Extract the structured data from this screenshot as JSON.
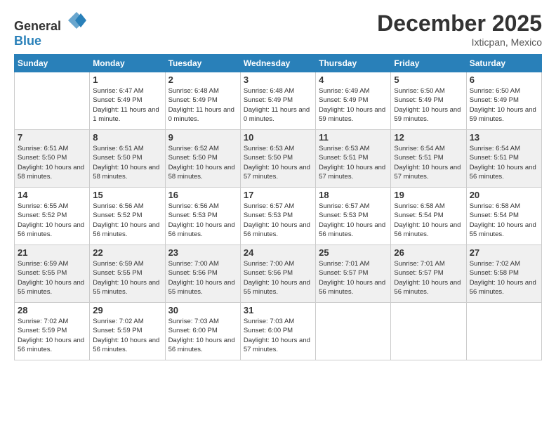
{
  "header": {
    "logo_general": "General",
    "logo_blue": "Blue",
    "month_title": "December 2025",
    "location": "Ixticpan, Mexico"
  },
  "days_of_week": [
    "Sunday",
    "Monday",
    "Tuesday",
    "Wednesday",
    "Thursday",
    "Friday",
    "Saturday"
  ],
  "weeks": [
    [
      {
        "day": "",
        "sunrise": "",
        "sunset": "",
        "daylight": "",
        "empty": true
      },
      {
        "day": "1",
        "sunrise": "Sunrise: 6:47 AM",
        "sunset": "Sunset: 5:49 PM",
        "daylight": "Daylight: 11 hours and 1 minute."
      },
      {
        "day": "2",
        "sunrise": "Sunrise: 6:48 AM",
        "sunset": "Sunset: 5:49 PM",
        "daylight": "Daylight: 11 hours and 0 minutes."
      },
      {
        "day": "3",
        "sunrise": "Sunrise: 6:48 AM",
        "sunset": "Sunset: 5:49 PM",
        "daylight": "Daylight: 11 hours and 0 minutes."
      },
      {
        "day": "4",
        "sunrise": "Sunrise: 6:49 AM",
        "sunset": "Sunset: 5:49 PM",
        "daylight": "Daylight: 10 hours and 59 minutes."
      },
      {
        "day": "5",
        "sunrise": "Sunrise: 6:50 AM",
        "sunset": "Sunset: 5:49 PM",
        "daylight": "Daylight: 10 hours and 59 minutes."
      },
      {
        "day": "6",
        "sunrise": "Sunrise: 6:50 AM",
        "sunset": "Sunset: 5:49 PM",
        "daylight": "Daylight: 10 hours and 59 minutes."
      }
    ],
    [
      {
        "day": "7",
        "sunrise": "Sunrise: 6:51 AM",
        "sunset": "Sunset: 5:50 PM",
        "daylight": "Daylight: 10 hours and 58 minutes."
      },
      {
        "day": "8",
        "sunrise": "Sunrise: 6:51 AM",
        "sunset": "Sunset: 5:50 PM",
        "daylight": "Daylight: 10 hours and 58 minutes."
      },
      {
        "day": "9",
        "sunrise": "Sunrise: 6:52 AM",
        "sunset": "Sunset: 5:50 PM",
        "daylight": "Daylight: 10 hours and 58 minutes."
      },
      {
        "day": "10",
        "sunrise": "Sunrise: 6:53 AM",
        "sunset": "Sunset: 5:50 PM",
        "daylight": "Daylight: 10 hours and 57 minutes."
      },
      {
        "day": "11",
        "sunrise": "Sunrise: 6:53 AM",
        "sunset": "Sunset: 5:51 PM",
        "daylight": "Daylight: 10 hours and 57 minutes."
      },
      {
        "day": "12",
        "sunrise": "Sunrise: 6:54 AM",
        "sunset": "Sunset: 5:51 PM",
        "daylight": "Daylight: 10 hours and 57 minutes."
      },
      {
        "day": "13",
        "sunrise": "Sunrise: 6:54 AM",
        "sunset": "Sunset: 5:51 PM",
        "daylight": "Daylight: 10 hours and 56 minutes."
      }
    ],
    [
      {
        "day": "14",
        "sunrise": "Sunrise: 6:55 AM",
        "sunset": "Sunset: 5:52 PM",
        "daylight": "Daylight: 10 hours and 56 minutes."
      },
      {
        "day": "15",
        "sunrise": "Sunrise: 6:56 AM",
        "sunset": "Sunset: 5:52 PM",
        "daylight": "Daylight: 10 hours and 56 minutes."
      },
      {
        "day": "16",
        "sunrise": "Sunrise: 6:56 AM",
        "sunset": "Sunset: 5:53 PM",
        "daylight": "Daylight: 10 hours and 56 minutes."
      },
      {
        "day": "17",
        "sunrise": "Sunrise: 6:57 AM",
        "sunset": "Sunset: 5:53 PM",
        "daylight": "Daylight: 10 hours and 56 minutes."
      },
      {
        "day": "18",
        "sunrise": "Sunrise: 6:57 AM",
        "sunset": "Sunset: 5:53 PM",
        "daylight": "Daylight: 10 hours and 56 minutes."
      },
      {
        "day": "19",
        "sunrise": "Sunrise: 6:58 AM",
        "sunset": "Sunset: 5:54 PM",
        "daylight": "Daylight: 10 hours and 56 minutes."
      },
      {
        "day": "20",
        "sunrise": "Sunrise: 6:58 AM",
        "sunset": "Sunset: 5:54 PM",
        "daylight": "Daylight: 10 hours and 55 minutes."
      }
    ],
    [
      {
        "day": "21",
        "sunrise": "Sunrise: 6:59 AM",
        "sunset": "Sunset: 5:55 PM",
        "daylight": "Daylight: 10 hours and 55 minutes."
      },
      {
        "day": "22",
        "sunrise": "Sunrise: 6:59 AM",
        "sunset": "Sunset: 5:55 PM",
        "daylight": "Daylight: 10 hours and 55 minutes."
      },
      {
        "day": "23",
        "sunrise": "Sunrise: 7:00 AM",
        "sunset": "Sunset: 5:56 PM",
        "daylight": "Daylight: 10 hours and 55 minutes."
      },
      {
        "day": "24",
        "sunrise": "Sunrise: 7:00 AM",
        "sunset": "Sunset: 5:56 PM",
        "daylight": "Daylight: 10 hours and 55 minutes."
      },
      {
        "day": "25",
        "sunrise": "Sunrise: 7:01 AM",
        "sunset": "Sunset: 5:57 PM",
        "daylight": "Daylight: 10 hours and 56 minutes."
      },
      {
        "day": "26",
        "sunrise": "Sunrise: 7:01 AM",
        "sunset": "Sunset: 5:57 PM",
        "daylight": "Daylight: 10 hours and 56 minutes."
      },
      {
        "day": "27",
        "sunrise": "Sunrise: 7:02 AM",
        "sunset": "Sunset: 5:58 PM",
        "daylight": "Daylight: 10 hours and 56 minutes."
      }
    ],
    [
      {
        "day": "28",
        "sunrise": "Sunrise: 7:02 AM",
        "sunset": "Sunset: 5:59 PM",
        "daylight": "Daylight: 10 hours and 56 minutes."
      },
      {
        "day": "29",
        "sunrise": "Sunrise: 7:02 AM",
        "sunset": "Sunset: 5:59 PM",
        "daylight": "Daylight: 10 hours and 56 minutes."
      },
      {
        "day": "30",
        "sunrise": "Sunrise: 7:03 AM",
        "sunset": "Sunset: 6:00 PM",
        "daylight": "Daylight: 10 hours and 56 minutes."
      },
      {
        "day": "31",
        "sunrise": "Sunrise: 7:03 AM",
        "sunset": "Sunset: 6:00 PM",
        "daylight": "Daylight: 10 hours and 57 minutes."
      },
      {
        "day": "",
        "sunrise": "",
        "sunset": "",
        "daylight": "",
        "empty": true
      },
      {
        "day": "",
        "sunrise": "",
        "sunset": "",
        "daylight": "",
        "empty": true
      },
      {
        "day": "",
        "sunrise": "",
        "sunset": "",
        "daylight": "",
        "empty": true
      }
    ]
  ]
}
